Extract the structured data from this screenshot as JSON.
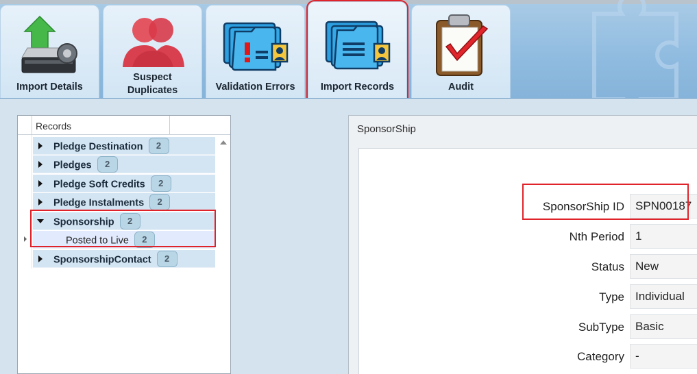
{
  "ribbon": {
    "tabs": [
      {
        "label": "Import Details",
        "icon": "database-import-icon"
      },
      {
        "label": "Suspect Duplicates",
        "icon": "duplicate-people-icon"
      },
      {
        "label": "Validation Errors",
        "icon": "folder-error-icon"
      },
      {
        "label": "Import Records",
        "icon": "folder-records-icon",
        "selected": true
      },
      {
        "label": "Audit",
        "icon": "clipboard-check-icon"
      }
    ]
  },
  "tree": {
    "header": "Records",
    "rows": [
      {
        "label": "Pledge Destination",
        "count": "2",
        "expanded": false
      },
      {
        "label": "Pledges",
        "count": "2",
        "expanded": false
      },
      {
        "label": "Pledge Soft Credits",
        "count": "2",
        "expanded": false
      },
      {
        "label": "Pledge Instalments",
        "count": "2",
        "expanded": false
      },
      {
        "label": "Sponsorship",
        "count": "2",
        "expanded": true
      },
      {
        "label": "Posted to Live",
        "count": "2",
        "child": true
      },
      {
        "label": "SponsorshipContact",
        "count": "2",
        "expanded": false
      }
    ]
  },
  "detail": {
    "title": "SponsorShip",
    "fields": [
      {
        "label": "SponsorShip ID",
        "value": "SPN00187"
      },
      {
        "label": "Nth Period",
        "value": "1"
      },
      {
        "label": "Status",
        "value": "New"
      },
      {
        "label": "Type",
        "value": "Individual"
      },
      {
        "label": "SubType",
        "value": "Basic"
      },
      {
        "label": "Category",
        "value": "-"
      }
    ]
  },
  "colors": {
    "highlight": "#e0232b",
    "ribbon": "#8fbbe0",
    "row": "#d3e4f3",
    "badge": "#b9d6e6"
  }
}
